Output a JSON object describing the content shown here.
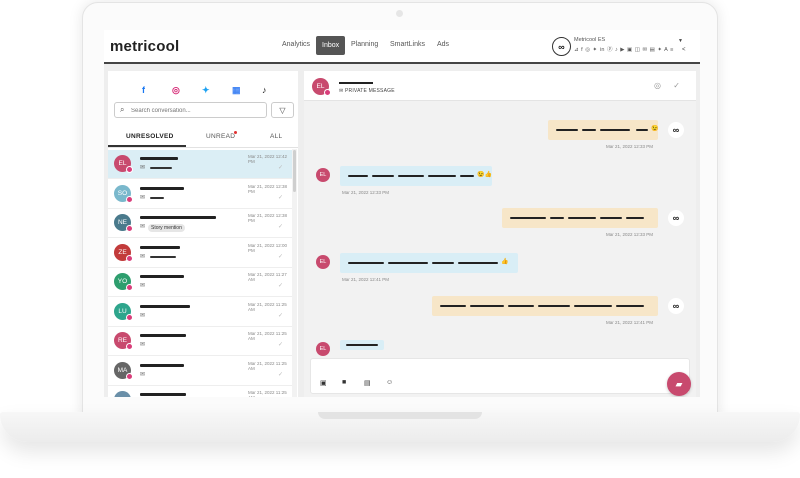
{
  "app": {
    "logo": "metricool"
  },
  "nav": [
    {
      "label": "Analytics",
      "active": false
    },
    {
      "label": "Inbox",
      "active": true
    },
    {
      "label": "Planning",
      "active": false
    },
    {
      "label": "SmartLinks",
      "active": false
    },
    {
      "label": "Ads",
      "active": false
    }
  ],
  "brand": {
    "name": "Metricool ES",
    "avatar_glyph": "∞",
    "icons": "⊿ f ◎ ✦ in ⓟ ♪ ▶ ▣ ◫ ✉ ▤ ✦ A ≡"
  },
  "networks": [
    {
      "icon": "facebook-icon",
      "glyph": "f",
      "color": "#1877f2"
    },
    {
      "icon": "instagram-icon",
      "glyph": "◎",
      "color": "#d62976"
    },
    {
      "icon": "twitter-icon",
      "glyph": "✦",
      "color": "#1da1f2"
    },
    {
      "icon": "google-business-icon",
      "glyph": "▦",
      "color": "#4285f4"
    },
    {
      "icon": "tiktok-icon",
      "glyph": "♪",
      "color": "#111111"
    }
  ],
  "search": {
    "placeholder": "Search conversation..."
  },
  "tabs": [
    {
      "label": "UNRESOLVED",
      "active": true
    },
    {
      "label": "UNREAD",
      "active": false,
      "has_dot": true
    },
    {
      "label": "ALL",
      "active": false
    }
  ],
  "conversations": [
    {
      "initials": "EL",
      "color": "#c84a6e",
      "date": "Mar 21, 2022 12:42 PM",
      "selected": true
    },
    {
      "initials": "SO",
      "color": "#7ab8cc",
      "date": "Mar 21, 2022 12:38 PM",
      "selected": false
    },
    {
      "initials": "NE",
      "color": "#4a7a8c",
      "date": "Mar 21, 2022 12:38 PM",
      "selected": false,
      "tag": "Story mention"
    },
    {
      "initials": "ZE",
      "color": "#c23b3b",
      "date": "Mar 21, 2022 12:00 PM",
      "selected": false
    },
    {
      "initials": "YO",
      "color": "#2e9e6e",
      "date": "Mar 21, 2022 11:27 AM",
      "selected": false
    },
    {
      "initials": "LU",
      "color": "#2ea58c",
      "date": "Mar 21, 2022 11:25 AM",
      "selected": false
    },
    {
      "initials": "RE",
      "color": "#c84a6e",
      "date": "Mar 21, 2022 11:25 AM",
      "selected": false
    },
    {
      "initials": "MA",
      "color": "#666666",
      "date": "Mar 21, 2022 11:25 AM",
      "selected": false
    },
    {
      "initials": "",
      "color": "#6a8fa8",
      "date": "Mar 21, 2022 11:25 AM",
      "selected": false
    }
  ],
  "chat": {
    "contact_initials": "EL",
    "private_label": "PRIVATE MESSAGE",
    "messages": [
      {
        "dir": "out",
        "time": "Mar 21, 2022 12:33 PM",
        "emoji": "😉"
      },
      {
        "dir": "in",
        "initials": "EL",
        "time": "Mar 21, 2022 12:33 PM",
        "emoji": "😉👍"
      },
      {
        "dir": "out",
        "time": "Mar 21, 2022 12:33 PM",
        "emoji": ""
      },
      {
        "dir": "in",
        "initials": "EL",
        "time": "Mar 21, 2022 12:41 PM",
        "emoji": "👍"
      },
      {
        "dir": "out",
        "time": "Mar 21, 2022 12:41 PM",
        "emoji": ""
      },
      {
        "dir": "in",
        "initials": "EL",
        "time": "",
        "emoji": ""
      }
    ]
  },
  "colors": {
    "accent": "#c84a6e",
    "selected_row": "#dbeef5",
    "outgoing": "#f7e6c8",
    "incoming": "#d9eef6"
  }
}
